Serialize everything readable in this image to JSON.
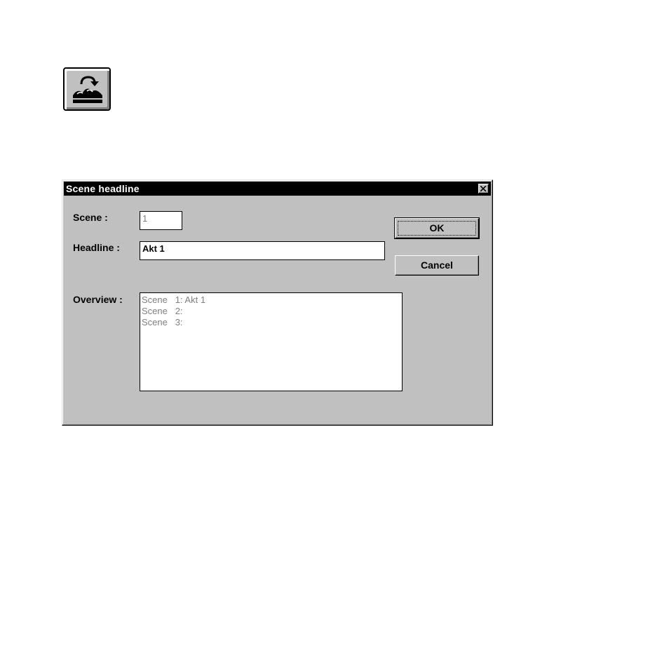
{
  "toolbar": {
    "scene_headline_icon": "scene-headline-icon"
  },
  "dialog": {
    "title": "Scene headline",
    "close_glyph": "close-icon",
    "scene_label": "Scene :",
    "scene_value": "1",
    "headline_label": "Headline :",
    "headline_value": "Akt 1",
    "overview_label": "Overview :",
    "overview_items": [
      "Scene   1: Akt 1",
      "Scene   2:",
      "Scene   3:"
    ],
    "ok_label": "OK",
    "cancel_label": "Cancel"
  },
  "colors": {
    "window_face": "#c0c0c0",
    "titlebar": "#000000",
    "disabled_text": "#808080"
  }
}
